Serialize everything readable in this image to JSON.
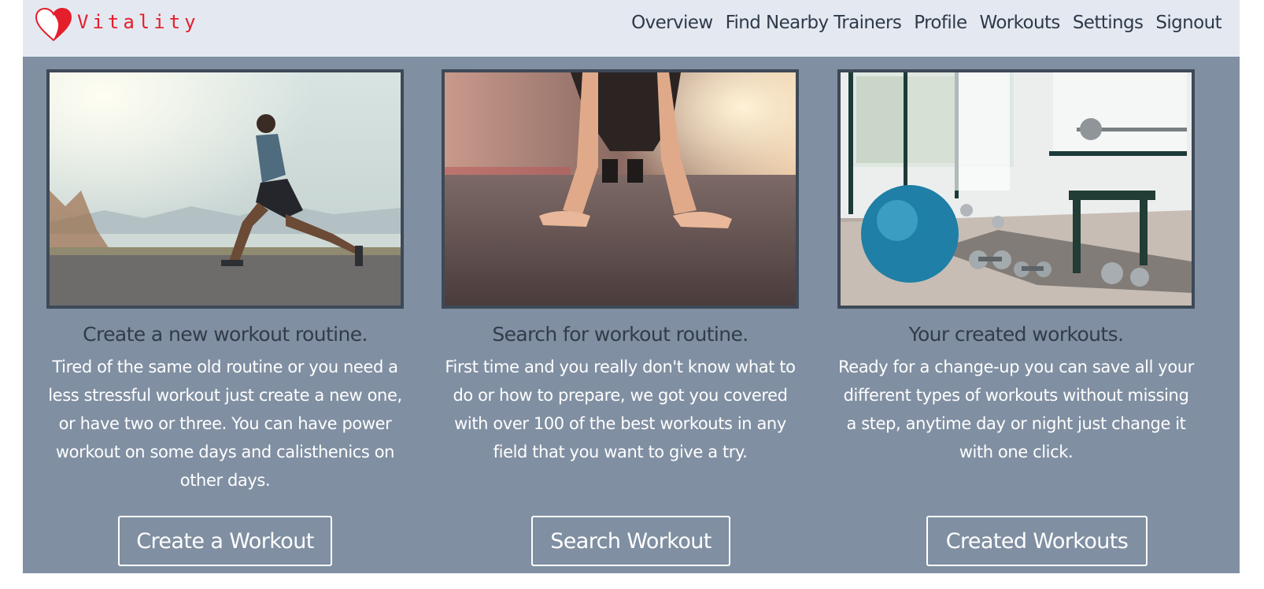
{
  "brand": {
    "name": "Vitality",
    "logo_icon": "heart-icon",
    "color": "#e41e2b"
  },
  "nav": {
    "items": [
      {
        "label": "Overview"
      },
      {
        "label": "Find Nearby Trainers"
      },
      {
        "label": "Profile"
      },
      {
        "label": "Workouts"
      },
      {
        "label": "Settings"
      },
      {
        "label": "Signout"
      }
    ]
  },
  "cards": [
    {
      "title": "Create a new workout routine.",
      "text": "Tired of the same old routine or you need a less stressful workout just create a new one, or have two or three. You can have power workout on some days and calisthenics on other days.",
      "button": "Create a Workout"
    },
    {
      "title": "Search for workout routine.",
      "text": "First time and you really don't know what to do or how to prepare, we got you covered with over 100 of the best workouts in any field that you want to give a try.",
      "button": "Search Workout"
    },
    {
      "title": "Your created workouts.",
      "text": "Ready for a change-up you can save all your different types of workouts without missing a step, anytime day or night just change it with one click.",
      "button": "Created Workouts"
    }
  ],
  "colors": {
    "navbar_bg": "#e4e9f1",
    "main_bg": "#808fa2",
    "title_text": "#323c49",
    "body_text": "#ffffff"
  }
}
